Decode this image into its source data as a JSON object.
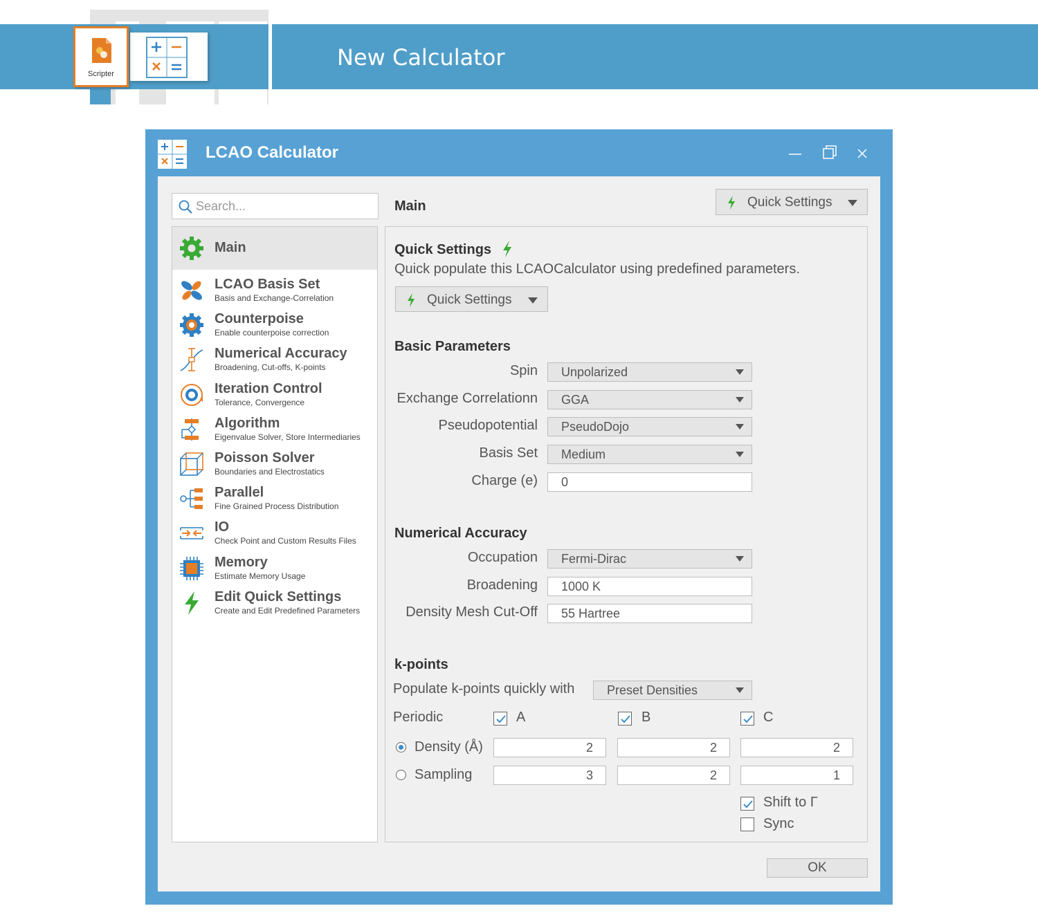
{
  "banner": {
    "title": "New Calculator",
    "scripter_label": "Scripter"
  },
  "window": {
    "title": "LCAO Calculator",
    "controls": [
      "minimize-icon",
      "maximize-icon",
      "close-icon"
    ]
  },
  "search": {
    "placeholder": "Search..."
  },
  "sidebar": {
    "items": [
      {
        "title": "Main",
        "subtitle": "",
        "icon": "gear-icon"
      },
      {
        "title": "LCAO Basis Set",
        "subtitle": "Basis and Exchange-Correlation",
        "icon": "orbital-icon"
      },
      {
        "title": "Counterpoise",
        "subtitle": "Enable counterpoise correction",
        "icon": "counterpoise-gear-icon"
      },
      {
        "title": "Numerical Accuracy",
        "subtitle": "Broadening, Cut-offs, K-points",
        "icon": "accuracy-icon"
      },
      {
        "title": "Iteration Control",
        "subtitle": "Tolerance, Convergence",
        "icon": "iteration-icon"
      },
      {
        "title": "Algorithm",
        "subtitle": "Eigenvalue Solver, Store Intermediaries",
        "icon": "algorithm-icon"
      },
      {
        "title": "Poisson Solver",
        "subtitle": "Boundaries and Electrostatics",
        "icon": "cube-icon"
      },
      {
        "title": "Parallel",
        "subtitle": "Fine Grained Process Distribution",
        "icon": "parallel-icon"
      },
      {
        "title": "IO",
        "subtitle": "Check Point and Custom Results Files",
        "icon": "io-icon"
      },
      {
        "title": "Memory",
        "subtitle": "Estimate Memory Usage",
        "icon": "chip-icon"
      },
      {
        "title": "Edit Quick Settings",
        "subtitle": "Create and Edit Predefined Parameters",
        "icon": "bolt-icon"
      }
    ]
  },
  "main": {
    "title": "Main",
    "quick_settings_button": "Quick Settings",
    "quick": {
      "title": "Quick Settings",
      "description": "Quick populate this LCAOCalculator using predefined parameters.",
      "button": "Quick Settings"
    },
    "basic": {
      "title": "Basic Parameters",
      "spin_label": "Spin",
      "spin_value": "Unpolarized",
      "xc_label": "Exchange Correlationn",
      "xc_value": "GGA",
      "pseudo_label": "Pseudopotential",
      "pseudo_value": "PseudoDojo",
      "basis_label": "Basis Set",
      "basis_value": "Medium",
      "charge_label": "Charge (e)",
      "charge_value": "0"
    },
    "numerical": {
      "title": "Numerical Accuracy",
      "occupation_label": "Occupation",
      "occupation_value": "Fermi-Dirac",
      "broadening_label": "Broadening",
      "broadening_value": "1000 K",
      "density_mesh_label": "Density Mesh Cut-Off",
      "density_mesh_value": "55 Hartree"
    },
    "kpoints": {
      "title": "k-points",
      "populate_label": "Populate k-points quickly with",
      "populate_value": "Preset Densities",
      "periodic_label": "Periodic",
      "axes": [
        "A",
        "B",
        "C"
      ],
      "periodic_checked": [
        true,
        true,
        true
      ],
      "density_label": "Density (Å)",
      "density_values": [
        "2",
        "2",
        "2"
      ],
      "sampling_label": "Sampling",
      "sampling_values": [
        "3",
        "2",
        "1"
      ],
      "selected_mode": "density",
      "shift_label": "Shift to Γ",
      "shift_checked": true,
      "sync_label": "Sync",
      "sync_checked": false
    },
    "ok_label": "OK"
  },
  "colors": {
    "banner": "#4f9ec9",
    "window": "#57a1d5",
    "accent_orange": "#e57e25",
    "accent_green": "#3aa935",
    "accent_blue": "#2f80c3"
  }
}
